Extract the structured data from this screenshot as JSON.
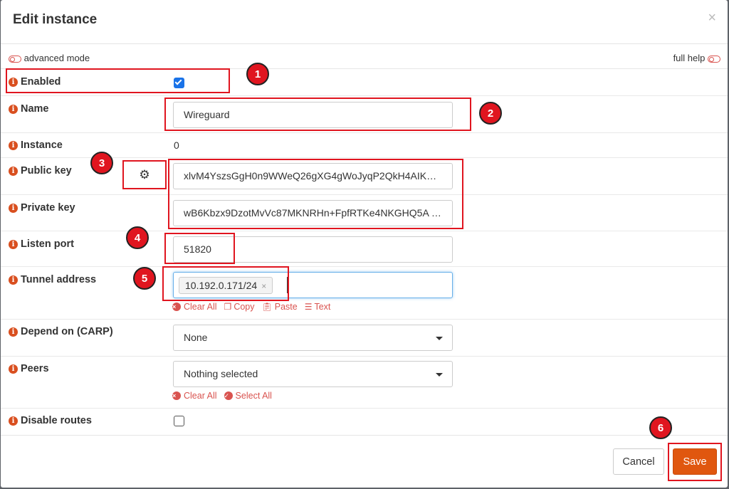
{
  "dialog": {
    "title": "Edit instance",
    "close_symbol": "×"
  },
  "toolbar": {
    "advanced_mode": "advanced mode",
    "full_help": "full help"
  },
  "fields": {
    "enabled": {
      "label": "Enabled",
      "checked": true
    },
    "name": {
      "label": "Name",
      "value": "Wireguard"
    },
    "instance": {
      "label": "Instance",
      "value": "0"
    },
    "public_key": {
      "label": "Public key",
      "value": "xlvM4YszsGgH0n9WWeQ26gXG4gWoJyqP2QkH4AIKS…"
    },
    "private_key": {
      "label": "Private key",
      "value": "wB6Kbzx9DzotMvVc87MKNRHn+FpfRTKe4NKGHQ5A …"
    },
    "listen_port": {
      "label": "Listen port",
      "value": "51820"
    },
    "tunnel_address": {
      "label": "Tunnel address",
      "tag": "10.192.0.171/24",
      "tag_remove": "×",
      "actions": {
        "clear_all": "Clear All",
        "copy": "Copy",
        "paste": "Paste",
        "text": "Text"
      }
    },
    "depend_on": {
      "label": "Depend on (CARP)",
      "value": "None"
    },
    "peers": {
      "label": "Peers",
      "value": "Nothing selected",
      "actions": {
        "clear_all": "Clear All",
        "select_all": "Select All"
      }
    },
    "disable_routes": {
      "label": "Disable routes",
      "checked": false
    }
  },
  "buttons": {
    "cancel": "Cancel",
    "save": "Save"
  },
  "annotations": [
    "1",
    "2",
    "3",
    "4",
    "5",
    "6"
  ],
  "colors": {
    "accent": "#e0570f",
    "info_icon": "#d94f1f",
    "link_red": "#d9534f",
    "annotation_red": "#e0151f",
    "checkbox_blue": "#1a73e8"
  }
}
